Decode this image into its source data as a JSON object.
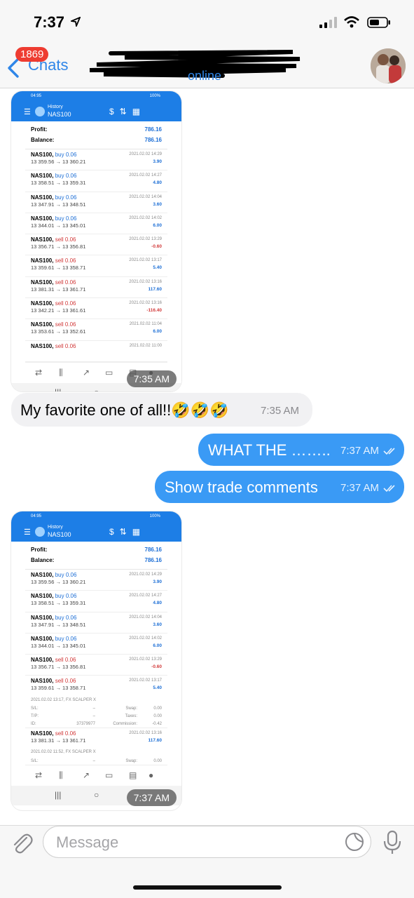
{
  "status_bar": {
    "time": "7:37"
  },
  "header": {
    "back_label": "Chats",
    "unread_badge": "1869",
    "status": "online"
  },
  "messages": {
    "image1": {
      "status_time": "04:95",
      "status_right": "100%",
      "screen_label": "History",
      "symbol": "NAS100",
      "profit_label": "Profit:",
      "profit_value": "786.16",
      "balance_label": "Balance:",
      "balance_value": "786.16",
      "trades": [
        {
          "symbol": "NAS100,",
          "side": "buy 0.06",
          "prices": "13 359.56 → 13 360.21",
          "date": "2021.02.02 14:29",
          "pl": "3.90"
        },
        {
          "symbol": "NAS100,",
          "side": "buy 0.06",
          "prices": "13 358.51 → 13 359.31",
          "date": "2021.02.02 14:27",
          "pl": "4.80"
        },
        {
          "symbol": "NAS100,",
          "side": "buy 0.06",
          "prices": "13 347.91 → 13 348.51",
          "date": "2021.02.02 14:04",
          "pl": "3.60"
        },
        {
          "symbol": "NAS100,",
          "side": "buy 0.06",
          "prices": "13 344.01 → 13 345.01",
          "date": "2021.02.02 14:02",
          "pl": "6.00"
        },
        {
          "symbol": "NAS100,",
          "side": "sell 0.06",
          "prices": "13 356.71 → 13 356.81",
          "date": "2021.02.02 13:29",
          "pl": "-0.60"
        },
        {
          "symbol": "NAS100,",
          "side": "sell 0.06",
          "prices": "13 359.61 → 13 358.71",
          "date": "2021.02.02 13:17",
          "pl": "5.40"
        },
        {
          "symbol": "NAS100,",
          "side": "sell 0.06",
          "prices": "13 381.31 → 13 361.71",
          "date": "2021.02.02 13:16",
          "pl": "117.60"
        },
        {
          "symbol": "NAS100,",
          "side": "sell 0.06",
          "prices": "13 342.21 → 13 361.61",
          "date": "2021.02.02 13:16",
          "pl": "-116.40"
        },
        {
          "symbol": "NAS100,",
          "side": "sell 0.06",
          "prices": "13 353.61 → 13 352.61",
          "date": "2021.02.02 11:04",
          "pl": "6.00"
        },
        {
          "symbol": "NAS100,",
          "side": "sell 0.06",
          "prices": "",
          "date": "2021.02.02 11:00",
          "pl": ""
        }
      ],
      "time": "7:35 AM"
    },
    "text1": {
      "text": "My favorite one of all!!",
      "emoji": "🤣🤣🤣",
      "time": "7:35 AM"
    },
    "out1": {
      "text": "WHAT THE ……..",
      "time": "7:37 AM"
    },
    "out2": {
      "text": "Show trade comments",
      "time": "7:37 AM"
    },
    "image2": {
      "status_time": "04:95",
      "status_right": "100%",
      "screen_label": "History",
      "symbol": "NAS100",
      "profit_label": "Profit:",
      "profit_value": "786.16",
      "balance_label": "Balance:",
      "balance_value": "786.16",
      "trades": [
        {
          "symbol": "NAS100,",
          "side": "buy 0.06",
          "prices": "13 359.56 → 13 360.21",
          "date": "2021.02.02 14:29",
          "pl": "3.90"
        },
        {
          "symbol": "NAS100,",
          "side": "buy 0.06",
          "prices": "13 358.51 → 13 359.31",
          "date": "2021.02.02 14:27",
          "pl": "4.80"
        },
        {
          "symbol": "NAS100,",
          "side": "buy 0.06",
          "prices": "13 347.91 → 13 348.51",
          "date": "2021.02.02 14:04",
          "pl": "3.60"
        },
        {
          "symbol": "NAS100,",
          "side": "buy 0.06",
          "prices": "13 344.01 → 13 345.01",
          "date": "2021.02.02 14:02",
          "pl": "6.00"
        },
        {
          "symbol": "NAS100,",
          "side": "sell 0.06",
          "prices": "13 356.71 → 13 356.81",
          "date": "2021.02.02 13:29",
          "pl": "-0.60"
        }
      ],
      "expanded_trade": {
        "symbol": "NAS100,",
        "side": "sell 0.06",
        "prices": "13 359.61 → 13 358.71",
        "date": "2021.02.02 13:17",
        "pl": "5.40",
        "comment": "2021.02.02 13:17,  FX SCALPER X",
        "sl_label": "S/L:",
        "sl_value": "–",
        "swap_label": "Swap:",
        "swap_value": "0.00",
        "tp_label": "T/P:",
        "tp_value": "–",
        "taxes_label": "Taxes:",
        "taxes_value": "0.00",
        "id_label": "ID:",
        "id_value": "37379977",
        "commission_label": "Commission:",
        "commission_value": "-0.42"
      },
      "partial_trade": {
        "symbol": "NAS100,",
        "side": "sell 0.06",
        "prices": "13 381.31 → 13 361.71",
        "date": "2021.02.02 13:16",
        "pl": "117.60",
        "comment": "2021.02.02 11:52,  FX SCALPER X",
        "sl_label": "S/L:",
        "sl_value": "–",
        "swap_label": "Swap:",
        "swap_value": "0.00"
      },
      "time": "7:37 AM"
    }
  },
  "input": {
    "placeholder": "Message"
  },
  "colors": {
    "accent": "#2f86e8",
    "outgoing_bubble": "#3a9af5",
    "incoming_bubble": "#f1f1f3",
    "badge": "#ee3c31",
    "mt_blue": "#1d7ee6"
  }
}
